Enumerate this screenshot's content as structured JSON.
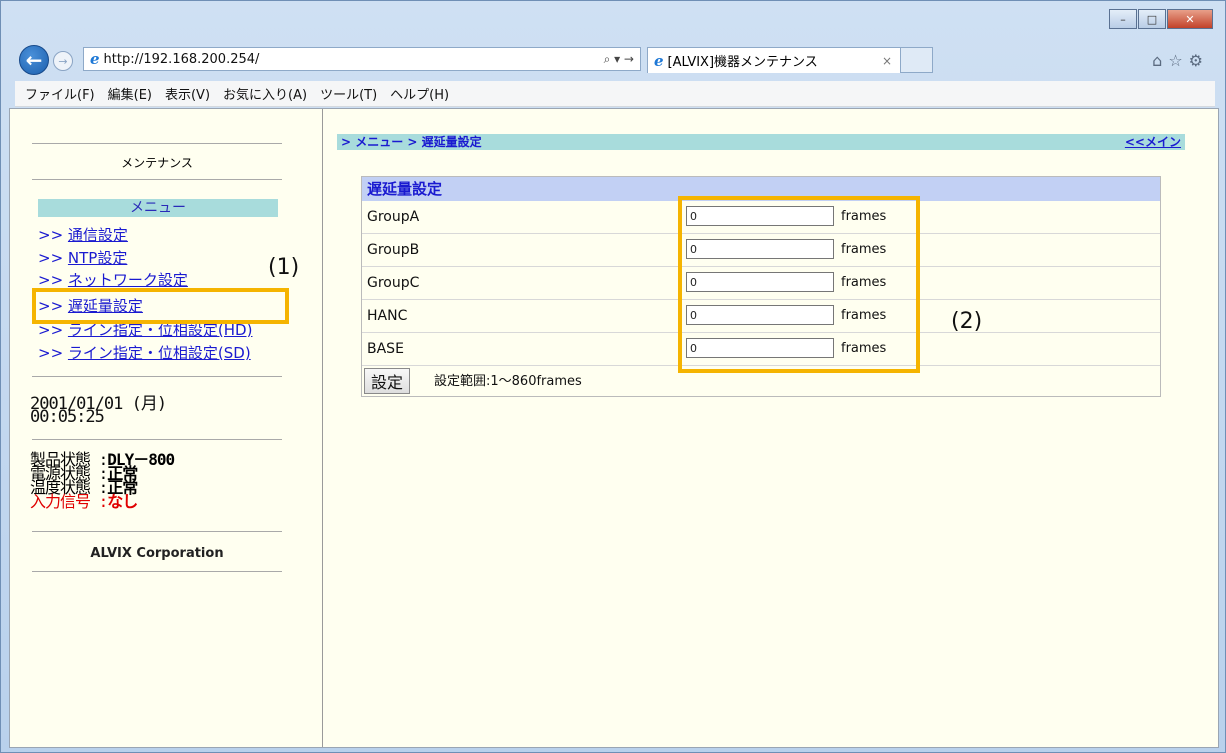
{
  "browser": {
    "address": "http://192.168.200.254/",
    "address_tools": "⌕ ▾ →",
    "tab_title": "[ALVIX]機器メンテナンス",
    "tab_close": "×",
    "right_icons": "⌂☆⚙",
    "window_controls": {
      "minimize": "–",
      "maximize": "□",
      "close": "✕"
    }
  },
  "menubar": [
    "ファイル(F)",
    "編集(E)",
    "表示(V)",
    "お気に入り(A)",
    "ツール(T)",
    "ヘルプ(H)"
  ],
  "left": {
    "title": "メンテナンス",
    "menu_header": "メニュー",
    "links": [
      {
        "arrow": ">>",
        "label": "通信設定"
      },
      {
        "arrow": ">>",
        "label": "NTP設定"
      },
      {
        "arrow": ">>",
        "label": "ネットワーク設定"
      },
      {
        "arrow": ">>",
        "label": "遅延量設定"
      },
      {
        "arrow": ">>",
        "label": "ライン指定・位相設定(HD)"
      },
      {
        "arrow": ">>",
        "label": "ライン指定・位相設定(SD)"
      }
    ],
    "date": "2001/01/01 (月)",
    "time": "00:05:25",
    "status": [
      {
        "label": "製品状態",
        "sep": ":",
        "value": "DLY－800"
      },
      {
        "label": "電源状態",
        "sep": ":",
        "value": "正常"
      },
      {
        "label": "温度状態",
        "sep": ":",
        "value": "正常"
      },
      {
        "label": "入力信号",
        "sep": ":",
        "value": "なし"
      }
    ],
    "company": "ALVIX Corporation"
  },
  "main": {
    "breadcrumb": "> メニュー > 遅延量設定",
    "back_link": "<<メイン",
    "form_title": "遅延量設定",
    "rows": [
      {
        "label": "GroupA",
        "value": "0",
        "unit": "frames"
      },
      {
        "label": "GroupB",
        "value": "0",
        "unit": "frames"
      },
      {
        "label": "GroupC",
        "value": "0",
        "unit": "frames"
      },
      {
        "label": "HANC",
        "value": "0",
        "unit": "frames"
      },
      {
        "label": "BASE",
        "value": "0",
        "unit": "frames"
      }
    ],
    "submit_label": "設定",
    "range_note": "設定範囲:1～860frames"
  },
  "annotations": {
    "a1": "(1)",
    "a2": "(2)"
  },
  "colors": {
    "highlight": "#f5b400",
    "link": "#1a1ad0",
    "alert": "#e00000",
    "page_bg": "#fffff0"
  }
}
